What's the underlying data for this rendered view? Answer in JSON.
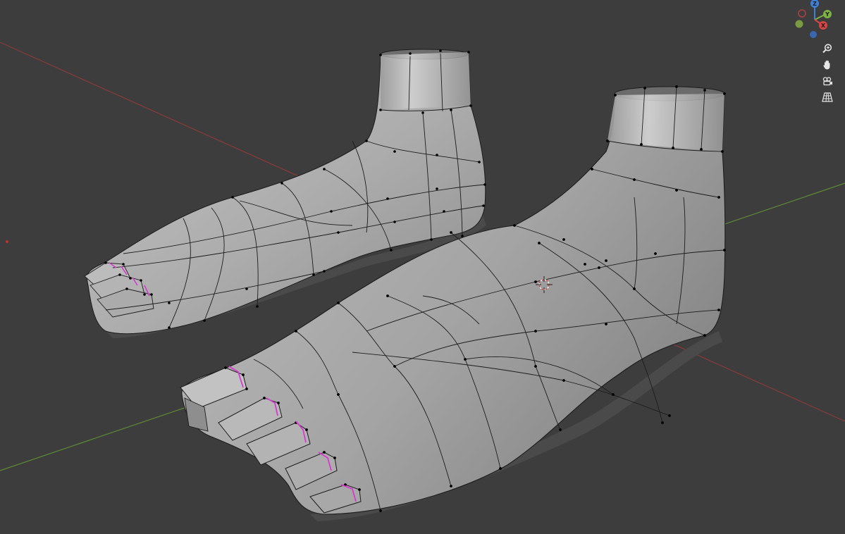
{
  "viewport": {
    "background": "#3d3d3d",
    "x_axis_color": "#8a3b3b",
    "y_axis_color": "#5e8a35",
    "origin_color": "#c03030",
    "mesh_fill": "#a9a9a9",
    "mesh_light": "#c8c8c8",
    "mesh_dark": "#8a8a8a",
    "wire_color": "#1c1c1c",
    "vertex_color": "#000000",
    "seam_color": "#d63ad0"
  },
  "gizmo": {
    "axes": [
      {
        "label": "Z",
        "color": "#3f7fd6"
      },
      {
        "label": "Y",
        "color": "#7cb342"
      },
      {
        "label": "X",
        "color": "#d84545"
      }
    ],
    "negative_colors": {
      "x": "#b04040",
      "y": "#7a9b3f",
      "z": "#3a67b2"
    }
  },
  "navigation": {
    "tools": [
      {
        "name": "zoom",
        "icon": "zoom-icon"
      },
      {
        "name": "pan",
        "icon": "hand-icon"
      },
      {
        "name": "camera",
        "icon": "camera-icon"
      },
      {
        "name": "perspective",
        "icon": "grid-icon"
      }
    ]
  }
}
